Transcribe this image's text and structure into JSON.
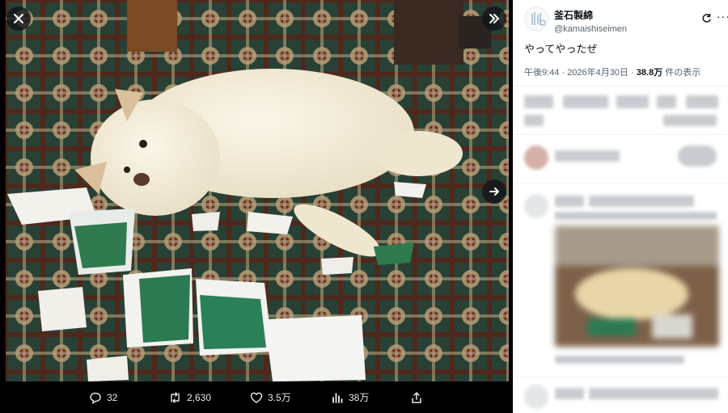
{
  "viewer": {
    "close_icon": "close-icon",
    "collapse_icon": "double-chevron-right-icon",
    "next_icon": "arrow-right-icon"
  },
  "actions": {
    "replies": "32",
    "reposts": "2,630",
    "likes": "3.5万",
    "views": "38万"
  },
  "tweet": {
    "display_name": "釜石製綿",
    "handle": "@kamaishiseimen",
    "text": "やってやったぜ",
    "time_date": "午後9:44 · 2026年4月30日 · ",
    "view_count": "38.8万",
    "view_suffix": " 件の表示"
  },
  "colors": {
    "panel_bg": "#ffffff",
    "viewer_bg": "#000000",
    "text_primary": "#0f1419",
    "text_secondary": "#536471"
  }
}
